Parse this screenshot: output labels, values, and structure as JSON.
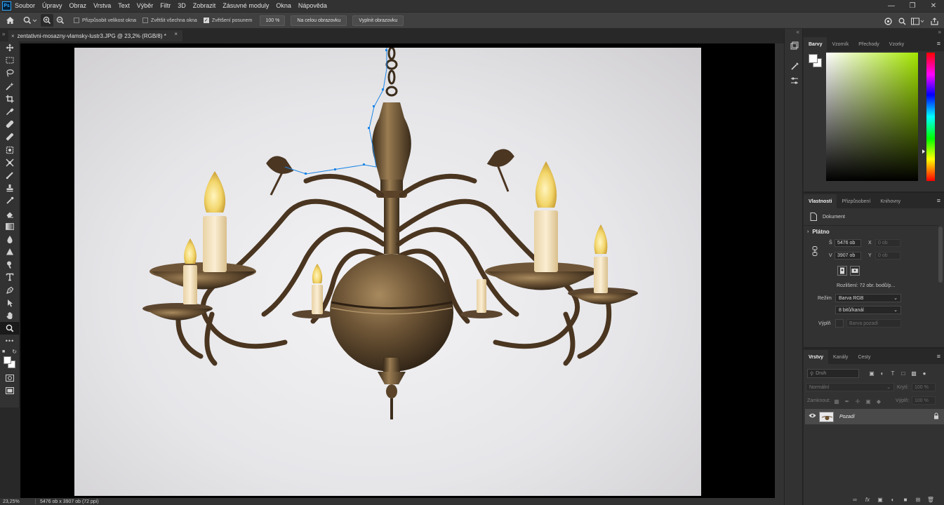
{
  "menu": [
    "Soubor",
    "Úpravy",
    "Obraz",
    "Vrstva",
    "Text",
    "Výběr",
    "Filtr",
    "3D",
    "Zobrazit",
    "Zásuvné moduly",
    "Okna",
    "Nápověda"
  ],
  "logo": "Ps",
  "options": {
    "fit_window": "Přizpůsobit velikost okna",
    "zoom_all": "Zvětšit všechna okna",
    "scrubby_zoom": "Zvětšení posunem",
    "zoom_value": "100 %",
    "fit_screen": "Na celou obrazovku",
    "fill_screen": "Vyplnit obrazovku",
    "scrubby_checked": true
  },
  "document": {
    "tab_title": "zentativni-mosazny-vlamsky-lustr3.JPG @ 23,2% (RGB/8) *"
  },
  "status": {
    "zoom": "23,25%",
    "info": "5476 ob x 3907 ob (72 ppi)"
  },
  "color_panel": {
    "tabs": [
      "Barvy",
      "Vzorník",
      "Přechody",
      "Vzorky"
    ],
    "hue_base": "#a4e600"
  },
  "properties_panel": {
    "tabs": [
      "Vlastnosti",
      "Přizpůsobení",
      "Knihovny"
    ],
    "doc_label": "Dokument",
    "section": "Plátno",
    "w_label": "Š",
    "w_value": "5476 ob",
    "h_label": "V",
    "h_value": "3907 ob",
    "x_label": "X",
    "x_value": "0 ob",
    "y_label": "Y",
    "y_value": "0 ob",
    "resolution": "Rozlišení: 72 obr. bodů/p...",
    "mode_label": "Režim",
    "mode_value": "Barva RGB",
    "depth_value": "8 bitů/kanál",
    "fill_label": "Výplň",
    "fill_value": "Barva pozadí"
  },
  "layers_panel": {
    "tabs": [
      "Vrstvy",
      "Kanály",
      "Cesty"
    ],
    "search_placeholder": "Druh",
    "blend_mode": "Normální",
    "opacity_label": "Krytí:",
    "opacity_value": "100 %",
    "lock_label": "Zamknout:",
    "fill_label": "Výplň:",
    "fill_value": "100 %",
    "layer_name": "Pozadí"
  }
}
